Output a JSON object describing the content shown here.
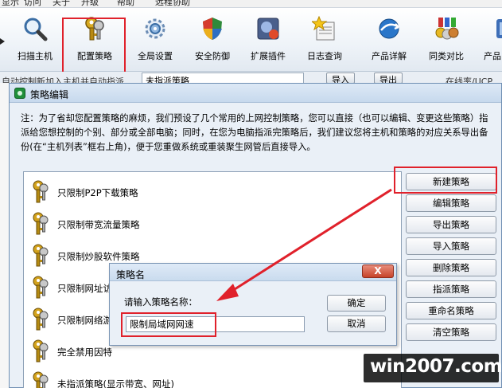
{
  "menubar": {
    "items": [
      "显示",
      "访问",
      "关于",
      "升级",
      "帮助",
      "远程协助"
    ]
  },
  "toolbar": {
    "buttons": [
      {
        "label": "扫描主机",
        "icon": "magnifier-icon"
      },
      {
        "label": "配置策略",
        "icon": "keys-icon"
      },
      {
        "label": "全局设置",
        "icon": "gear-icon"
      },
      {
        "label": "安全防御",
        "icon": "shield-icon"
      },
      {
        "label": "扩展插件",
        "icon": "plugin-icon"
      },
      {
        "label": "日志查询",
        "icon": "log-star-icon"
      },
      {
        "label": "产品详解",
        "icon": "globe-arrow-icon"
      },
      {
        "label": "同类对比",
        "icon": "medals-icon"
      },
      {
        "label": "产品",
        "icon": "product-icon"
      }
    ]
  },
  "filterrow": {
    "left_text": "自动控制新加入主机并自动指派",
    "select_value": "未指派策略",
    "btn1": "导入",
    "btn2": "导出",
    "right_text": "在线率/UCP"
  },
  "dialog": {
    "title": "策略编辑",
    "note": "注：为了省却您配置策略的麻烦，我们预设了几个常用的上网控制策略，您可以直接（也可以编辑、变更这些策略）指派给您想控制的个别、部分或全部电脑；同时，在您为电脑指派完策略后，我们建议您将主机和策略的对应关系导出备份(在“主机列表”框右上角)，便于您重做系统或重装聚生网管后直接导入。",
    "policies": [
      "只限制P2P下载策略",
      "只限制带宽流量策略",
      "只限制炒股软件策略",
      "只限制网址访",
      "只限制网络游",
      "完全禁用因特",
      "未指派策略(显示带宽、网址)"
    ],
    "buttons": [
      "新建策略",
      "编辑策略",
      "导出策略",
      "导入策略",
      "删除策略",
      "指派策略",
      "重命名策略",
      "清空策略"
    ]
  },
  "name_dialog": {
    "title": "策略名",
    "close": "X",
    "prompt": "请输入策略名称：",
    "input_value": "限制局域网网速",
    "ok": "确定",
    "cancel": "取消"
  },
  "watermark": "win2007.com",
  "colors": {
    "highlight_red": "#e0212b",
    "dialog_bg": "#eaf0f7"
  }
}
